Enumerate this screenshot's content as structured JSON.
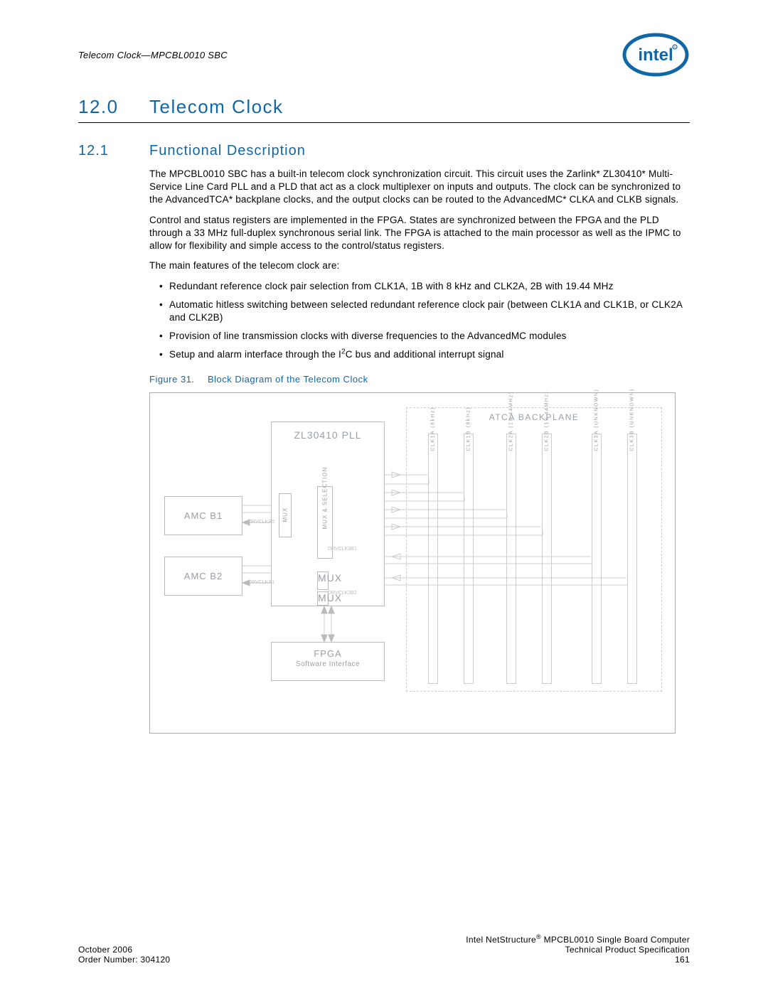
{
  "header": {
    "running_head": "Telecom Clock—MPCBL0010 SBC",
    "logo_name": "intel"
  },
  "section": {
    "number": "12.0",
    "title": "Telecom Clock"
  },
  "subsection": {
    "number": "12.1",
    "title": "Functional Description"
  },
  "paragraphs": {
    "p1": "The MPCBL0010 SBC has a built-in telecom clock synchronization circuit. This circuit uses the Zarlink* ZL30410* Multi-Service Line Card PLL and a PLD that act as a clock multiplexer on inputs and outputs. The clock can be synchronized to the AdvancedTCA* backplane clocks, and the output clocks can be routed to the AdvancedMC* CLKA and CLKB signals.",
    "p2": "Control and status registers are implemented in the FPGA. States are synchronized between the FPGA and the PLD through a 33 MHz full-duplex synchronous serial link. The FPGA is attached to the main processor as well as the IPMC to allow for flexibility and simple access to the control/status registers.",
    "p3": "The main features of the telecom clock are:"
  },
  "features": [
    "Redundant reference clock pair selection from CLK1A, 1B with 8 kHz and CLK2A, 2B with 19.44 MHz",
    "Automatic hitless switching between selected redundant reference clock pair (between CLK1A and CLK1B, or CLK2A and CLK2B)",
    "Provision of line transmission clocks with diverse frequencies to the AdvancedMC modules",
    "Setup and alarm interface through the I²C bus and additional interrupt signal"
  ],
  "figure": {
    "label": "Figure 31.",
    "title": "Block Diagram of the Telecom Clock"
  },
  "diagram": {
    "pll": "ZL30410 PLL",
    "pll_mux": "MUX",
    "pll_sel": "MUX & SELECTION",
    "amc_b1": "AMC B1",
    "amc_b2": "AMC B2",
    "fpga": "FPGA",
    "fpga_sub": "Software Interface",
    "atca_title": "ATCA BACKPLANE",
    "drvclka0": "DRVCLKA0",
    "drvclka1": "DRVCLKA1",
    "drvclka3b1": "DRVCLK3B1",
    "drvclka3b2": "DRVCLK3B2",
    "bars": [
      "CLK1A (8kHz)",
      "CLK1B (8kHz)",
      "CLK2A (19.44MHz)",
      "CLK2B (19.44MHz)",
      "CLK3A (UNKNOWN)",
      "CLK3B (UNKNOWN)"
    ]
  },
  "footer": {
    "left1": "October 2006",
    "left2": "Order Number: 304120",
    "right1_a": "Intel NetStructure",
    "right1_b": " MPCBL0010 Single Board Computer",
    "right2": "Technical Product Specification",
    "right3": "161",
    "reg": "®"
  }
}
